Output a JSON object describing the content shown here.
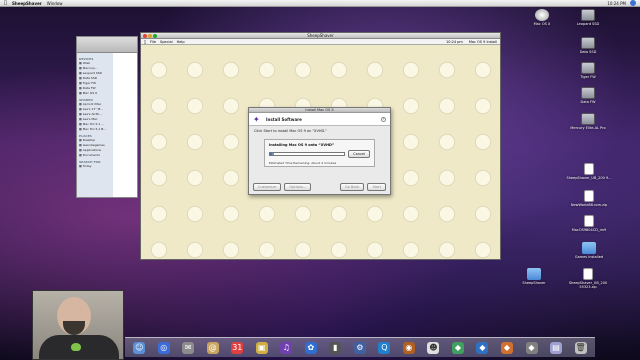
{
  "menubar": {
    "apple_icon": "apple-icon",
    "app_name": "SheepShaver",
    "menus": [
      "Window"
    ],
    "clock": "10:24 PM",
    "spotlight_icon": "spotlight-icon"
  },
  "finder": {
    "sections": {
      "devices": "DEVICES",
      "shared": "SHARED",
      "places": "PLACES",
      "search": "SEARCH FOR"
    },
    "devices": [
      "iDisk",
      "Mercury...",
      "Leopard SSD",
      "Data SSD",
      "Tiger FW",
      "Data FW",
      "Mac OS 9"
    ],
    "shared": [
      "Apricot iMac",
      "Lee's 17\" M...",
      "Lee's AirPo...",
      "Lee's Mac",
      "Mac Pro 5,1 ...",
      "Mac Pro 5,1 B..."
    ],
    "places": [
      "Desktop",
      "leeindiegames",
      "Applications",
      "Documents"
    ],
    "search": [
      "Today"
    ]
  },
  "sheepshaver": {
    "window_title": "SheepShaver",
    "os_menus": [
      "File",
      "Special",
      "Help"
    ],
    "os_clock": "10:24 pm",
    "os_disk": "Mac OS 9 Install"
  },
  "install_dialog": {
    "window_title": "Install Mac OS 9",
    "header_title": "Install Software",
    "instruction": "Click Start to install Mac OS 9 on “XVHD.”",
    "installing_label": "Installing Mac OS 9 onto “XVHD”",
    "progress": 0.05,
    "time_remaining": "Estimated Time Remaining: About 4 minutes",
    "cancel": "Cancel",
    "customize": "Customize",
    "options": "Options...",
    "go_back": "Go Back",
    "start": "Start"
  },
  "desktop_icons": {
    "macos_x": "Mac OS X",
    "leopard_ssd": "Leopard SSD",
    "data_ssd": "Data SSD",
    "tiger_fw": "Tiger FW",
    "data_fw": "Data FW",
    "mercury": "Mercury Elite-AL Pro",
    "sheepshaver_file": "SheepShaver_UB_200 9...",
    "newworld": "NewWorld86.rom.zip",
    "mac9804": "MacOS9804CD_im9",
    "games": "Games Installed",
    "sheepshaver_folder": "SheepShaver",
    "sheepshaver_zip": "SheepShaver_UB_200 55323.zip"
  },
  "colors": {
    "accent": "#3a74d0",
    "dialog_bg": "#eaeaea",
    "mac_platinum": "#efe9c7"
  }
}
